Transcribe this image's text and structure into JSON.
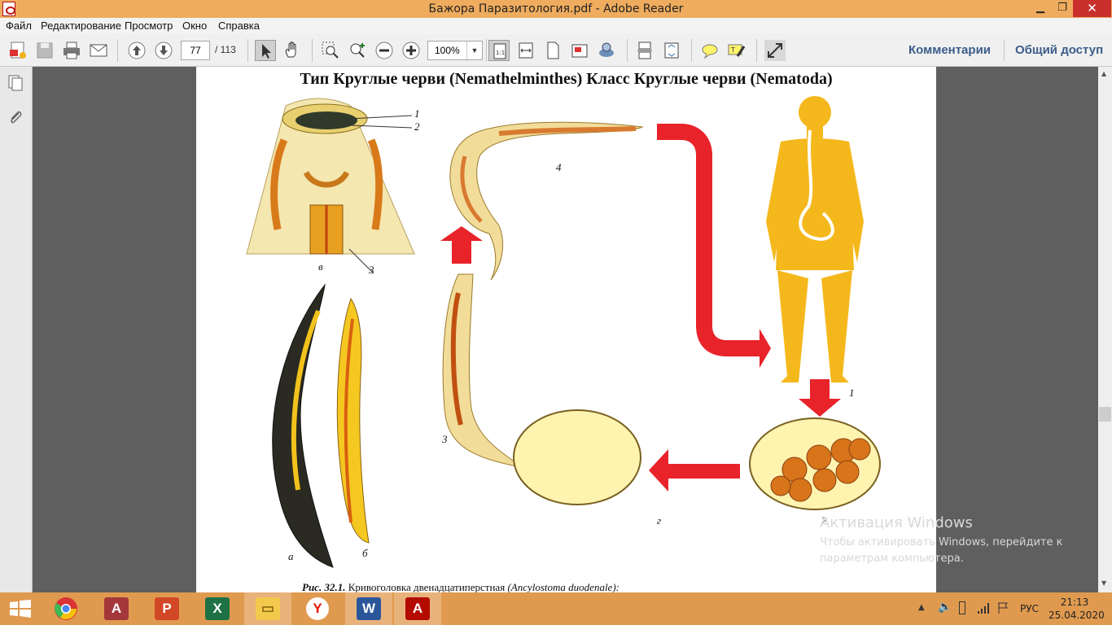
{
  "window": {
    "title": "Бажора Паразитология.pdf - Adobe Reader",
    "minimize": "▁",
    "restore": "❐",
    "close": "✕"
  },
  "menu": {
    "items": [
      "Файл",
      "Редактирование",
      "Просмотр",
      "Окно",
      "Справка"
    ]
  },
  "toolbar": {
    "page_current": "77",
    "page_total": "/  113",
    "zoom": "100%",
    "zoom_arrow": "▼",
    "comments_label": "Комментарии",
    "share_label": "Общий доступ"
  },
  "document": {
    "heading": "Тип Круглые черви (Nemathelminthes) Класс Круглые черви (Nematoda)",
    "labels": {
      "l1_top": "1",
      "l2_top": "2",
      "l3_top": "3",
      "v": "в",
      "l4": "4",
      "l3_mid": "3",
      "a": "а",
      "b": "б",
      "l1_human": "1",
      "l2_eggs": "2",
      "g": "г"
    },
    "caption_prefix": "Рис. 32.1.",
    "caption_text": " Кривоголовка двенадцатиперстная ",
    "caption_latin": "(Ancylostoma duodenale):"
  },
  "watermark": {
    "title": "Активация Windows",
    "line1": "Чтобы активировать Windows, перейдите к",
    "line2": "параметрам компьютера."
  },
  "taskbar": {
    "apps": [
      "start",
      "chrome",
      "access",
      "powerpoint",
      "excel",
      "explorer",
      "yandex",
      "word",
      "acrobat"
    ],
    "lang": "РУС",
    "time": "21:13",
    "date": "25.04.2020"
  },
  "colors": {
    "titlebar": "#efac5e",
    "taskbar": "#e09a4f",
    "arrow_red": "#e8232a",
    "body_yellow": "#f5b81c",
    "link_blue": "#3b5d8a"
  }
}
